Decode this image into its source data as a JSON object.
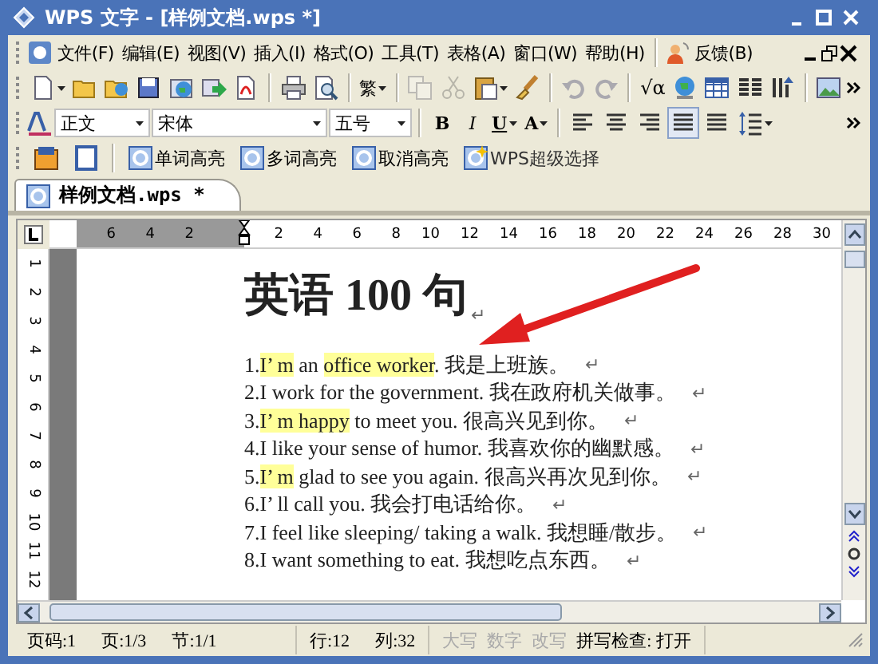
{
  "window": {
    "title": "WPS 文字 - [样例文档.wps *]"
  },
  "menu_bar": {
    "items": [
      "文件(F)",
      "编辑(E)",
      "视图(V)",
      "插入(I)",
      "格式(O)",
      "工具(T)",
      "表格(A)",
      "窗口(W)",
      "帮助(H)"
    ],
    "feedback": "反馈(B)"
  },
  "standard_toolbar": {
    "traditional_button": "繁",
    "formula_button": "√α",
    "copy_enabled": false,
    "cut_enabled": false,
    "undo_enabled": false,
    "redo_enabled": false
  },
  "format_toolbar": {
    "style": "正文",
    "font": "宋体",
    "size": "五号",
    "bold": "B",
    "italic": "I",
    "underline": "U",
    "font_color": "A",
    "alignments": [
      {
        "selected": false
      },
      {
        "selected": false
      },
      {
        "selected": false
      },
      {
        "selected": true
      },
      {
        "selected": false
      }
    ]
  },
  "highlight_toolbar": {
    "buttons": [
      "单词高亮",
      "多词高亮",
      "取消高亮",
      "WPS超级选择"
    ]
  },
  "tabs": [
    {
      "label": "样例文档.wps *",
      "selected": true
    }
  ],
  "ruler": {
    "left_numbers": [
      "6",
      "4",
      "2"
    ],
    "right_numbers": [
      "2",
      "4",
      "6",
      "8",
      "10",
      "12",
      "14",
      "16",
      "18",
      "20",
      "22",
      "24",
      "26",
      "28",
      "30"
    ],
    "vertical_numbers": [
      "1",
      "2",
      "3",
      "4",
      "5",
      "6",
      "7",
      "8",
      "9",
      "10",
      "11",
      "12"
    ]
  },
  "document": {
    "title": "英语 100 句",
    "paragraph_mark": "↵",
    "lines": [
      {
        "segments": [
          {
            "text": "1.",
            "highlighted": false
          },
          {
            "text": "I’ m",
            "highlighted": true
          },
          {
            "text": " an ",
            "highlighted": false
          },
          {
            "text": "office worker",
            "highlighted": true
          },
          {
            "text": ". 我是上班族。",
            "highlighted": false
          }
        ]
      },
      {
        "segments": [
          {
            "text": "2.I work for the government. 我在政府机关做事。",
            "highlighted": false
          }
        ]
      },
      {
        "segments": [
          {
            "text": "3.",
            "highlighted": false
          },
          {
            "text": "I’ m happy",
            "highlighted": true
          },
          {
            "text": " to meet you. 很高兴见到你。",
            "highlighted": false
          }
        ]
      },
      {
        "segments": [
          {
            "text": "4.I like your sense of humor. 我喜欢你的幽默感。",
            "highlighted": false
          }
        ]
      },
      {
        "segments": [
          {
            "text": "5.",
            "highlighted": false
          },
          {
            "text": "I’ m",
            "highlighted": true
          },
          {
            "text": " glad to see you again. 很高兴再次见到你。",
            "highlighted": false
          }
        ]
      },
      {
        "segments": [
          {
            "text": "6.I’ ll call you. 我会打电话给你。",
            "highlighted": false
          }
        ]
      },
      {
        "segments": [
          {
            "text": "7.I feel like sleeping/ taking a walk. 我想睡/散步。",
            "highlighted": false
          }
        ]
      },
      {
        "segments": [
          {
            "text": "8.I want something to eat. 我想吃点东西。",
            "highlighted": false
          }
        ]
      }
    ]
  },
  "status_bar": {
    "left": [
      "页码:1",
      "页:1/3",
      "节:1/1"
    ],
    "position": [
      "行:12",
      "列:32"
    ],
    "modes": [
      {
        "text": "大写",
        "enabled": false
      },
      {
        "text": "数字",
        "enabled": false
      },
      {
        "text": "改写",
        "enabled": false
      }
    ],
    "spell_check": "拼写检查: 打开"
  }
}
